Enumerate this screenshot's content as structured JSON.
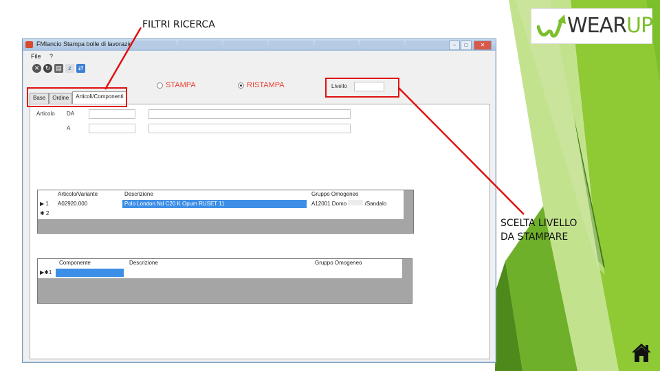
{
  "callouts": {
    "filtri": "FILTRI RICERCA",
    "livello_line1": "SCELTA LIVELLO",
    "livello_line2": "DA STAMPARE"
  },
  "logo": {
    "text_w": "WEAR",
    "text_up": "UP"
  },
  "colors": {
    "green_dark": "#4e8a1b",
    "green_mid": "#7bbf2a",
    "green_light": "#b9dd7a",
    "callout_red": "#e01010",
    "selected_row": "#3d8ee6"
  },
  "window": {
    "title": "FMlancio Stampa bolle di lavorazione",
    "menu": [
      "File",
      "?"
    ],
    "toolbar_icons": [
      "exit-icon",
      "refresh-icon",
      "print-icon",
      "sort-az-icon",
      "export-icon"
    ]
  },
  "tabs": [
    "Base",
    "Ordine",
    "Articoli/Componenti"
  ],
  "radios": {
    "stampa": "STAMPA",
    "ristampa": "RISTAMPA",
    "selected": "ristampa"
  },
  "livello": {
    "label": "Livello",
    "value": ""
  },
  "articolo_filter": {
    "label": "Articolo",
    "da_label": "DA",
    "a_label": "A",
    "da_value": "",
    "a_value": ""
  },
  "grid1": {
    "columns": [
      "Articolo/Variante",
      "Descrizione",
      "Gruppo Omogeneo"
    ],
    "rows": [
      {
        "marker": "▶ 1",
        "articolo": "A02920.000",
        "descrizione": "Polo London Nd C20 K Opum RUSET 11",
        "gruppo": "A12001 Domo",
        "gruppo_tail": "/Sandalo"
      }
    ],
    "new_row_marker": "✱ 2"
  },
  "grid2": {
    "columns": [
      "Componente",
      "Descrizione",
      "Gruppo Omogeneo"
    ],
    "new_row_marker": "▶✱1"
  }
}
